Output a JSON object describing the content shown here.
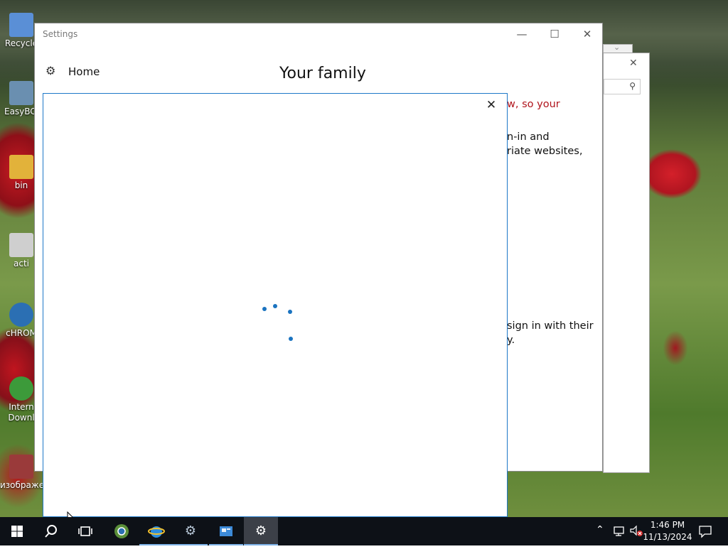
{
  "desktop": {
    "icons": [
      {
        "name": "recycle-bin",
        "label": "Recycle",
        "color": "#5a8fd6"
      },
      {
        "name": "easybcd",
        "label": "EasyBCl",
        "color": "#6a8fb0"
      },
      {
        "name": "bin-folder",
        "label": "bin",
        "color": "#e2b23a"
      },
      {
        "name": "activator",
        "label": "acti",
        "color": "#cfcfcf"
      },
      {
        "name": "chrome-shortcut",
        "label": "cHROM",
        "color": "#2b6fb3"
      },
      {
        "name": "internet-download-manager",
        "label": "Intern Downl",
        "color": "#3c9a3a"
      },
      {
        "name": "images-folder",
        "label": "изображе",
        "color": "#9a3a3a"
      }
    ]
  },
  "background_window": {
    "close_glyph": "✕",
    "search_glyph": "⚲"
  },
  "settings_window": {
    "title": "Settings",
    "minimize_glyph": "—",
    "maximize_glyph": "☐",
    "close_glyph": "✕",
    "home_label": "Home",
    "page_title": "Your family",
    "peek_lines": [
      {
        "text": "w, so your",
        "color": "#b0141c"
      },
      {
        "text": "n-in and",
        "color": "#111111"
      },
      {
        "text": "riate websites,",
        "color": "#111111"
      },
      {
        "text": "sign in with their",
        "color": "#111111"
      },
      {
        "text": "y.",
        "color": "#111111"
      }
    ]
  },
  "modal": {
    "close_glyph": "✕",
    "loading_color": "#1a73c0"
  },
  "taskbar": {
    "start_glyph": "⊞",
    "search_glyph": "⚲",
    "taskview_glyph": "⧉",
    "apps": [
      {
        "name": "chrome-taskbar-app",
        "active": false
      },
      {
        "name": "internet-explorer-taskbar-app",
        "active": false
      },
      {
        "name": "settings-gears-taskbar-app",
        "active": false
      },
      {
        "name": "control-panel-taskbar-app",
        "active": false
      },
      {
        "name": "settings-taskbar-app",
        "active": true
      }
    ],
    "tray": {
      "chevron_glyph": "⌃",
      "time": "1:46 PM",
      "date": "11/13/2024",
      "notification_glyph": "🗨"
    }
  }
}
